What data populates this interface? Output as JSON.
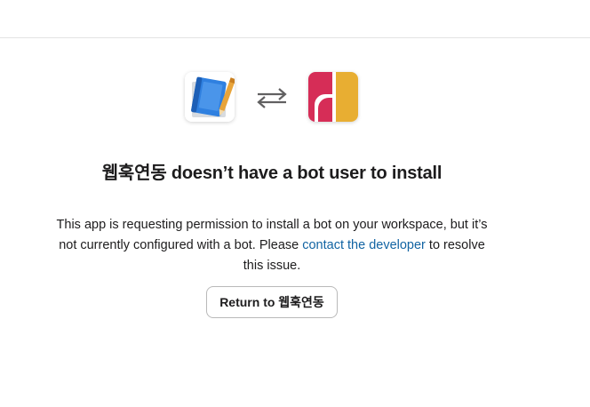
{
  "page": {
    "title": "웹훅연동 doesn’t have a bot user to install",
    "description_before_link": "This app is requesting permission to install a bot on your workspace, but it’s not currently configured with a bot. Please ",
    "link_text": "contact the developer",
    "description_after_link": " to resolve this issue.",
    "button_label": "Return to 웹훅연동"
  },
  "icons": {
    "app": "notebook-app-icon",
    "swap": "swap-arrows-icon",
    "workspace": "workspace-logo-icon"
  },
  "colors": {
    "link": "#1264a3",
    "workspace_red": "#d62d57",
    "workspace_yellow": "#e8ae32",
    "notebook_blue": "#2f80e0",
    "pencil": "#e8a43a"
  }
}
